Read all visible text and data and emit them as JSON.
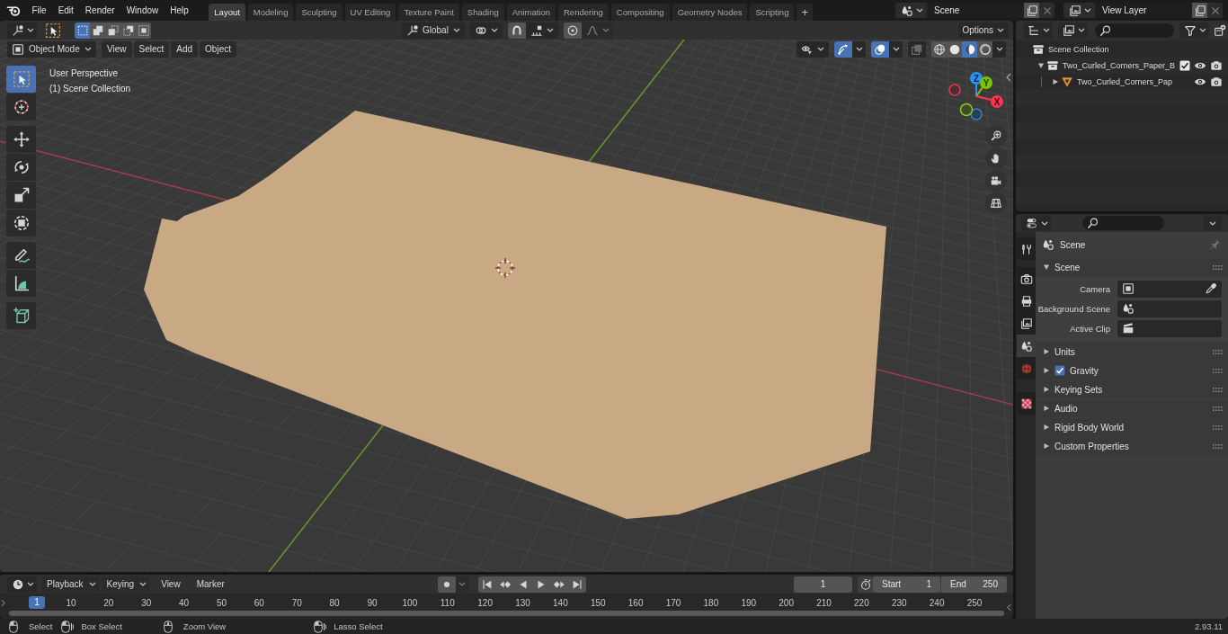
{
  "top_bar": {
    "menus": [
      "File",
      "Edit",
      "Render",
      "Window",
      "Help"
    ],
    "workspace_tabs": [
      {
        "label": "Layout",
        "selected": true
      },
      {
        "label": "Modeling",
        "selected": false
      },
      {
        "label": "Sculpting",
        "selected": false
      },
      {
        "label": "UV Editing",
        "selected": false
      },
      {
        "label": "Texture Paint",
        "selected": false
      },
      {
        "label": "Shading",
        "selected": false
      },
      {
        "label": "Animation",
        "selected": false
      },
      {
        "label": "Rendering",
        "selected": false
      },
      {
        "label": "Compositing",
        "selected": false
      },
      {
        "label": "Geometry Nodes",
        "selected": false
      },
      {
        "label": "Scripting",
        "selected": false
      }
    ],
    "add_tab": "+",
    "scene": "Scene",
    "view_layer": "View Layer"
  },
  "viewport": {
    "select_modes": [
      {
        "selected": true
      },
      {
        "selected": false
      },
      {
        "selected": false
      },
      {
        "selected": false
      },
      {
        "selected": false
      }
    ],
    "transform_orientation": "Global",
    "options": "Options",
    "mode": "Object Mode",
    "menus": [
      "View",
      "Select",
      "Add",
      "Object"
    ],
    "gizmos": {
      "on": true
    },
    "overlays": {
      "on": true
    },
    "xray": {
      "on": false
    },
    "shading_modes": [
      {
        "selected": false
      },
      {
        "selected": false
      },
      {
        "selected": true
      },
      {
        "selected": false
      }
    ],
    "overlay_text": [
      "User Perspective",
      "(1) Scene Collection"
    ],
    "tool_groups": [
      [
        {
          "selected": true
        },
        {
          "selected": false
        }
      ],
      [
        {
          "selected": false
        },
        {
          "selected": false
        },
        {
          "selected": false
        },
        {
          "selected": false
        }
      ],
      [
        {
          "selected": false
        },
        {
          "selected": false
        }
      ],
      [
        {
          "selected": false
        }
      ]
    ],
    "axes": {
      "x": "X",
      "y": "Y",
      "z": "Z"
    }
  },
  "outliner": {
    "tree": [
      {
        "label": "Scene Collection",
        "kind": "scene_collection",
        "children": [
          {
            "label": "Two_Curled_Corners_Paper_B",
            "kind": "collection",
            "expanded": true,
            "checked": true,
            "children": [
              {
                "label": "Two_Curled_Corners_Pap",
                "kind": "object",
                "expanded": false
              }
            ]
          }
        ]
      }
    ]
  },
  "properties": {
    "tab_groups": [
      [
        {
          "selected": false
        }
      ],
      [
        {
          "selected": false
        },
        {
          "selected": false
        },
        {
          "selected": false
        },
        {
          "selected": true
        },
        {
          "selected": false
        }
      ],
      [
        {
          "selected": false
        }
      ]
    ],
    "context": "Scene",
    "panels": [
      {
        "title": "Scene",
        "kind": "plain",
        "expanded": true,
        "fields": [
          {
            "label": "Camera"
          },
          {
            "label": "Background Scene"
          },
          {
            "label": "Active Clip"
          }
        ]
      },
      {
        "title": "Units",
        "kind": "plain",
        "expanded": false
      },
      {
        "title": "Gravity",
        "kind": "toggle",
        "expanded": false,
        "checked": true
      },
      {
        "title": "Keying Sets",
        "kind": "plain",
        "expanded": false
      },
      {
        "title": "Audio",
        "kind": "plain",
        "expanded": false
      },
      {
        "title": "Rigid Body World",
        "kind": "plain",
        "expanded": false
      },
      {
        "title": "Custom Properties",
        "kind": "plain",
        "expanded": false
      }
    ]
  },
  "timeline": {
    "menus": [
      {
        "label": "Playback",
        "kind": "dropdown"
      },
      {
        "label": "Keying",
        "kind": "dropdown"
      },
      {
        "label": "View",
        "kind": "menu"
      },
      {
        "label": "Marker",
        "kind": "menu"
      }
    ],
    "current_frame": "1",
    "start_label": "Start",
    "start": "1",
    "end_label": "End",
    "end": "250",
    "ruler_current": "1",
    "ruler_ticks": [
      "10",
      "20",
      "30",
      "40",
      "50",
      "60",
      "70",
      "80",
      "90",
      "100",
      "110",
      "120",
      "130",
      "140",
      "150",
      "160",
      "170",
      "180",
      "190",
      "200",
      "210",
      "220",
      "230",
      "240",
      "250"
    ]
  },
  "status_bar": {
    "hints": [
      "Select",
      "Box Select",
      "Zoom View",
      "Lasso Select"
    ],
    "version": "2.93.11"
  }
}
